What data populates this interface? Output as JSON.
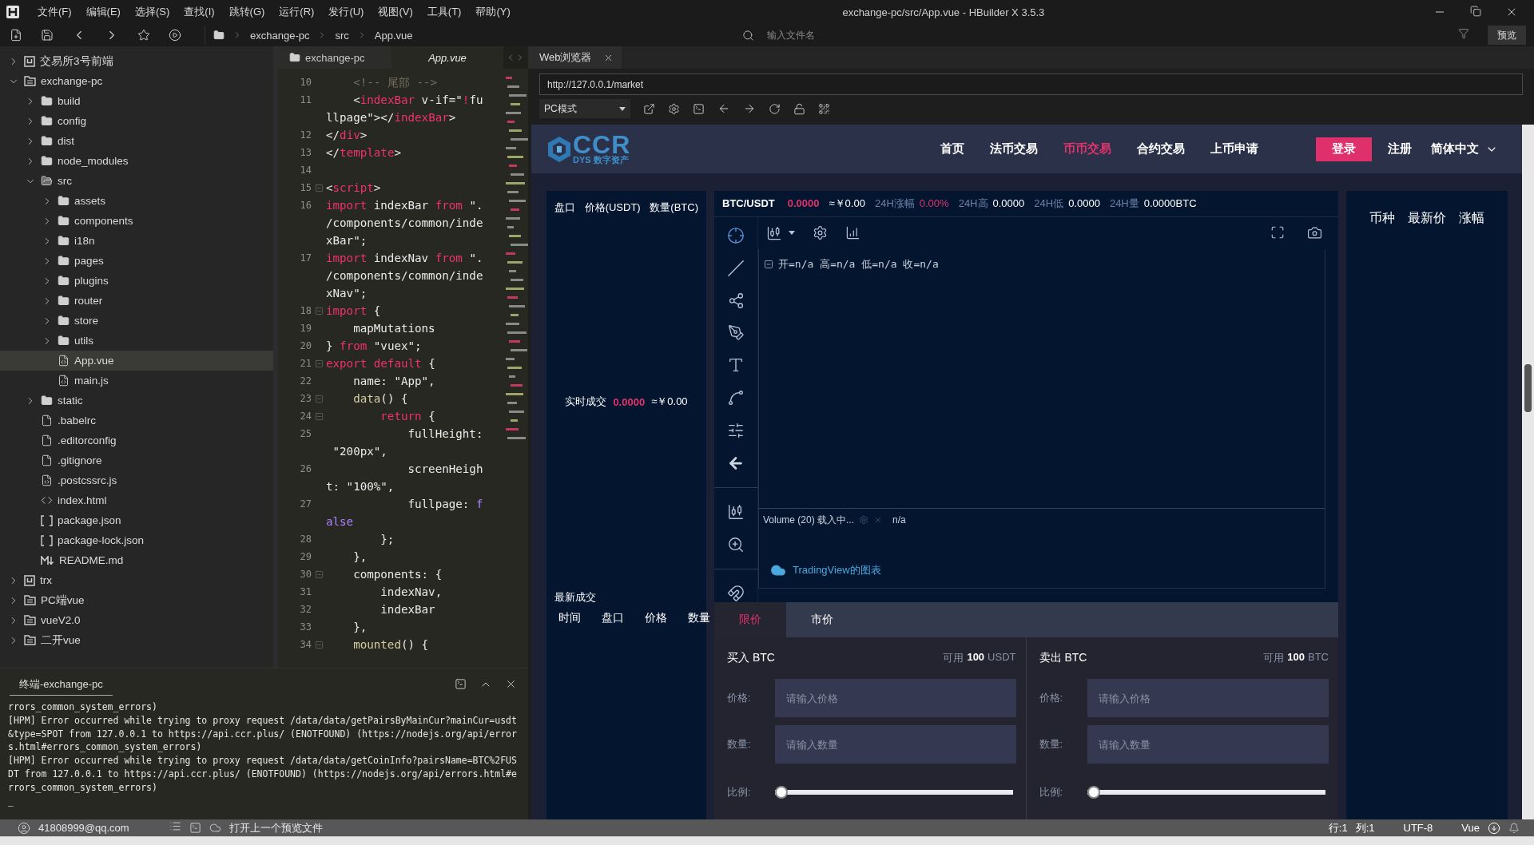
{
  "window": {
    "title": "exchange-pc/src/App.vue - HBuilder X 3.5.3"
  },
  "menu": [
    "文件(F)",
    "编辑(E)",
    "选择(S)",
    "查找(I)",
    "跳转(G)",
    "运行(R)",
    "发行(U)",
    "视图(V)",
    "工具(T)",
    "帮助(Y)"
  ],
  "toolbar": {
    "breadcrumb": [
      "exchange-pc",
      "src",
      "App.vue"
    ],
    "search": {
      "placeholder": "输入文件名"
    },
    "preview_button": "预览"
  },
  "project_tree": [
    {
      "label": "交易所3号前端",
      "kind": "project",
      "expanded": false,
      "selected": false
    },
    {
      "label": "exchange-pc",
      "kind": "project-folder",
      "expanded": true,
      "selected": false,
      "children": [
        {
          "label": "build",
          "kind": "folder",
          "expanded": false,
          "selected": false
        },
        {
          "label": "config",
          "kind": "folder",
          "expanded": false,
          "selected": false
        },
        {
          "label": "dist",
          "kind": "folder",
          "expanded": false,
          "selected": false
        },
        {
          "label": "node_modules",
          "kind": "folder",
          "expanded": false,
          "selected": false
        },
        {
          "label": "src",
          "kind": "folder",
          "expanded": true,
          "selected": false,
          "children": [
            {
              "label": "assets",
              "kind": "folder",
              "expanded": false,
              "selected": false
            },
            {
              "label": "components",
              "kind": "folder",
              "expanded": false,
              "selected": false
            },
            {
              "label": "i18n",
              "kind": "folder",
              "expanded": false,
              "selected": false
            },
            {
              "label": "pages",
              "kind": "folder",
              "expanded": false,
              "selected": false
            },
            {
              "label": "plugins",
              "kind": "folder",
              "expanded": false,
              "selected": false
            },
            {
              "label": "router",
              "kind": "folder",
              "expanded": false,
              "selected": false
            },
            {
              "label": "store",
              "kind": "folder",
              "expanded": false,
              "selected": false
            },
            {
              "label": "utils",
              "kind": "folder",
              "expanded": false,
              "selected": false
            },
            {
              "label": "App.vue",
              "kind": "vue",
              "selected": true
            },
            {
              "label": "main.js",
              "kind": "js",
              "selected": false
            }
          ]
        },
        {
          "label": "static",
          "kind": "folder",
          "expanded": false,
          "selected": false
        },
        {
          "label": ".babelrc",
          "kind": "file",
          "selected": false
        },
        {
          "label": ".editorconfig",
          "kind": "file",
          "selected": false
        },
        {
          "label": ".gitignore",
          "kind": "file",
          "selected": false
        },
        {
          "label": ".postcssrc.js",
          "kind": "js",
          "selected": false
        },
        {
          "label": "index.html",
          "kind": "html",
          "selected": false
        },
        {
          "label": "package.json",
          "kind": "json",
          "selected": false
        },
        {
          "label": "package-lock.json",
          "kind": "json",
          "selected": false
        },
        {
          "label": "README.md",
          "kind": "md",
          "selected": false
        }
      ]
    },
    {
      "label": "trx",
      "kind": "project",
      "expanded": false,
      "selected": false
    },
    {
      "label": "PC端vue",
      "kind": "project-folder",
      "expanded": false,
      "selected": false
    },
    {
      "label": "vueV2.0",
      "kind": "project-folder",
      "expanded": false,
      "selected": false
    },
    {
      "label": "二开vue",
      "kind": "project-folder",
      "expanded": false,
      "selected": false
    }
  ],
  "editor": {
    "tabs": [
      {
        "label": "exchange-pc",
        "selected": false
      },
      {
        "label": "App.vue",
        "selected": true
      }
    ],
    "rows": [
      {
        "number": "10",
        "fold": false,
        "tokens": [
          {
            "kind": "comment",
            "text": "    <!-- 尾部 -->"
          }
        ]
      },
      {
        "number": "11",
        "fold": false,
        "tokens": [
          {
            "kind": "plain",
            "text": "    <"
          },
          {
            "kind": "tag",
            "text": "indexBar"
          },
          {
            "kind": "plain",
            "text": " v-if=\""
          },
          {
            "kind": "tag",
            "text": "!"
          },
          {
            "kind": "plain",
            "text": "fu"
          }
        ]
      },
      {
        "fold": false,
        "tokens": [
          {
            "kind": "plain",
            "text": "llpage\"></"
          },
          {
            "kind": "tag",
            "text": "indexBar"
          },
          {
            "kind": "plain",
            "text": ">"
          }
        ]
      },
      {
        "number": "12",
        "fold": false,
        "tokens": [
          {
            "kind": "plain",
            "text": "</"
          },
          {
            "kind": "tag",
            "text": "div"
          },
          {
            "kind": "plain",
            "text": ">"
          }
        ]
      },
      {
        "number": "13",
        "fold": false,
        "tokens": [
          {
            "kind": "plain",
            "text": "</"
          },
          {
            "kind": "tag",
            "text": "template"
          },
          {
            "kind": "plain",
            "text": ">"
          }
        ]
      },
      {
        "number": "14",
        "fold": false,
        "tokens": []
      },
      {
        "number": "15",
        "fold": true,
        "tokens": [
          {
            "kind": "plain",
            "text": "<"
          },
          {
            "kind": "tag",
            "text": "script"
          },
          {
            "kind": "plain",
            "text": ">"
          }
        ]
      },
      {
        "number": "16",
        "fold": false,
        "tokens": [
          {
            "kind": "keyword",
            "text": "import"
          },
          {
            "kind": "plain",
            "text": " indexBar "
          },
          {
            "kind": "keyword",
            "text": "from"
          },
          {
            "kind": "plain",
            "text": " \"."
          }
        ]
      },
      {
        "fold": false,
        "tokens": [
          {
            "kind": "plain",
            "text": "/components/common/inde"
          }
        ]
      },
      {
        "fold": false,
        "tokens": [
          {
            "kind": "plain",
            "text": "xBar\";"
          }
        ]
      },
      {
        "number": "17",
        "fold": false,
        "tokens": [
          {
            "kind": "keyword",
            "text": "import"
          },
          {
            "kind": "plain",
            "text": " indexNav "
          },
          {
            "kind": "keyword",
            "text": "from"
          },
          {
            "kind": "plain",
            "text": " \"."
          }
        ]
      },
      {
        "fold": false,
        "tokens": [
          {
            "kind": "plain",
            "text": "/components/common/inde"
          }
        ]
      },
      {
        "fold": false,
        "tokens": [
          {
            "kind": "plain",
            "text": "xNav\";"
          }
        ]
      },
      {
        "number": "18",
        "fold": true,
        "tokens": [
          {
            "kind": "keyword",
            "text": "import"
          },
          {
            "kind": "plain",
            "text": " {"
          }
        ]
      },
      {
        "number": "19",
        "fold": false,
        "tokens": [
          {
            "kind": "plain",
            "text": "    mapMutations"
          }
        ]
      },
      {
        "number": "20",
        "fold": false,
        "tokens": [
          {
            "kind": "plain",
            "text": "} "
          },
          {
            "kind": "keyword",
            "text": "from"
          },
          {
            "kind": "plain",
            "text": " \"vuex\";"
          }
        ]
      },
      {
        "number": "21",
        "fold": true,
        "tokens": [
          {
            "kind": "keyword",
            "text": "export"
          },
          {
            "kind": "keyword",
            "text": " default"
          },
          {
            "kind": "plain",
            "text": " {"
          }
        ]
      },
      {
        "number": "22",
        "fold": false,
        "tokens": [
          {
            "kind": "plain",
            "text": "    name: \"App\","
          }
        ]
      },
      {
        "number": "23",
        "fold": true,
        "tokens": [
          {
            "kind": "func",
            "text": "    data"
          },
          {
            "kind": "plain",
            "text": "() {"
          }
        ]
      },
      {
        "number": "24",
        "fold": true,
        "tokens": [
          {
            "kind": "keyword",
            "text": "        return"
          },
          {
            "kind": "plain",
            "text": " {"
          }
        ]
      },
      {
        "number": "25",
        "fold": false,
        "tokens": [
          {
            "kind": "plain",
            "text": "            fullHeight:"
          }
        ]
      },
      {
        "fold": false,
        "tokens": [
          {
            "kind": "plain",
            "text": " \"200px\","
          }
        ]
      },
      {
        "number": "26",
        "fold": false,
        "tokens": [
          {
            "kind": "plain",
            "text": "            screenHeigh"
          }
        ]
      },
      {
        "fold": false,
        "tokens": [
          {
            "kind": "plain",
            "text": "t: \"100%\","
          }
        ]
      },
      {
        "number": "27",
        "fold": false,
        "tokens": [
          {
            "kind": "plain",
            "text": "            fullpage: "
          },
          {
            "kind": "constant",
            "text": "f"
          }
        ]
      },
      {
        "fold": false,
        "tokens": [
          {
            "kind": "constant",
            "text": "alse"
          }
        ]
      },
      {
        "number": "28",
        "fold": false,
        "tokens": [
          {
            "kind": "plain",
            "text": "        };"
          }
        ]
      },
      {
        "number": "29",
        "fold": false,
        "tokens": [
          {
            "kind": "plain",
            "text": "    },"
          }
        ]
      },
      {
        "number": "30",
        "fold": true,
        "tokens": [
          {
            "kind": "plain",
            "text": "    components: {"
          }
        ]
      },
      {
        "number": "31",
        "fold": false,
        "tokens": [
          {
            "kind": "plain",
            "text": "        indexNav,"
          }
        ]
      },
      {
        "number": "32",
        "fold": false,
        "tokens": [
          {
            "kind": "plain",
            "text": "        indexBar"
          }
        ]
      },
      {
        "number": "33",
        "fold": false,
        "tokens": [
          {
            "kind": "plain",
            "text": "    },"
          }
        ]
      },
      {
        "number": "34",
        "fold": true,
        "tokens": [
          {
            "kind": "func",
            "text": "    mounted"
          },
          {
            "kind": "plain",
            "text": "() {"
          }
        ]
      }
    ]
  },
  "terminal": {
    "tab": "终端-exchange-pc",
    "lines": [
      "rrors_common_system_errors)",
      "[HPM] Error occurred while trying to proxy request /data/data/getPairsByMainCur?mainCur=usdt",
      "&type=SPOT from 127.0.0.1 to https://api.ccr.plus/ (ENOTFOUND) (https://nodejs.org/api/error",
      "s.html#errors_common_system_errors)",
      "[HPM] Error occurred while trying to proxy request /data/data/getCoinInfo?pairsName=BTC%2FUS",
      "DT from 127.0.0.1 to https://api.ccr.plus/ (ENOTFOUND) (https://nodejs.org/api/errors.html#e",
      "rrors_common_system_errors)",
      "_"
    ]
  },
  "status_bar": {
    "account": "41808999@qq.com",
    "hint": "打开上一个预览文件",
    "line": "行:1",
    "column": "列:1",
    "encoding": "UTF-8",
    "language": "Vue"
  },
  "browser": {
    "tab": "Web浏览器",
    "url": "http://127.0.0.1/market",
    "mode": "PC模式",
    "page": {
      "header": {
        "logo": {
          "name": "CCR",
          "tag_1": "DYS",
          "tag_2": "数字资产"
        },
        "nav": [
          {
            "label": "首页",
            "selected": false
          },
          {
            "label": "法币交易",
            "selected": false
          },
          {
            "label": "币币交易",
            "selected": true
          },
          {
            "label": "合约交易",
            "selected": false
          },
          {
            "label": "上币申请",
            "selected": false
          }
        ],
        "login": "登录",
        "register": "注册",
        "language": "简体中文"
      },
      "order_book": {
        "columns": [
          "盘口",
          "价格(USDT)",
          "数量(BTC)"
        ],
        "realtime_label": "实时成交",
        "realtime_price": "0.0000",
        "realtime_cny": "≈￥0.00",
        "trades_title": "最新成交",
        "trades_columns": [
          "时间",
          "盘口",
          "价格",
          "数量"
        ]
      },
      "ticker": {
        "pair": "BTC/USDT",
        "price": "0.0000",
        "cny": "≈￥0.00",
        "stats": [
          {
            "label": "24H涨幅",
            "value": "0.00%",
            "kind": "change"
          },
          {
            "label": "24H高",
            "value": "0.0000",
            "kind": "plain"
          },
          {
            "label": "24H低",
            "value": "0.0000",
            "kind": "plain"
          },
          {
            "label": "24H量",
            "value": "0.0000BTC",
            "kind": "plain"
          }
        ]
      },
      "chart": {
        "legend": "开=n/a 高=n/a 低=n/a 收=n/a",
        "volume_label": "Volume (20) 载入中...",
        "volume_value": "n/a",
        "credit": "TradingView的图表"
      },
      "market_list": {
        "columns": [
          "币种",
          "最新价",
          "涨幅"
        ]
      },
      "order": {
        "tabs": [
          {
            "label": "限价",
            "selected": true
          },
          {
            "label": "市价",
            "selected": false
          }
        ],
        "sides": [
          {
            "title": "买入 BTC",
            "available_label": "可用",
            "available_amount": "100",
            "available_unit": "USDT",
            "price_label": "价格:",
            "price_placeholder": "请输入价格",
            "amount_label": "数量:",
            "amount_placeholder": "请输入数量",
            "ratio_label": "比例:",
            "level": 0
          },
          {
            "title": "卖出 BTC",
            "available_label": "可用",
            "available_amount": "100",
            "available_unit": "BTC",
            "price_label": "价格:",
            "price_placeholder": "请输入价格",
            "amount_label": "数量:",
            "amount_placeholder": "请输入数量",
            "ratio_label": "比例:",
            "level": 0
          }
        ]
      }
    }
  }
}
